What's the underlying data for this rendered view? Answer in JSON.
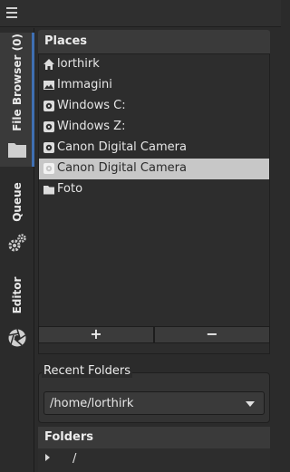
{
  "rail": {
    "tabs": [
      {
        "label": "File Browser (0)",
        "icon": "folder-icon",
        "active": true
      },
      {
        "label": "Queue",
        "icon": "gears-icon",
        "active": false
      },
      {
        "label": "Editor",
        "icon": "aperture-icon",
        "active": false
      }
    ]
  },
  "places": {
    "header": "Places",
    "items": [
      {
        "label": "lorthirk",
        "icon": "home-icon"
      },
      {
        "label": "Immagini",
        "icon": "image-icon"
      },
      {
        "label": "Windows C:",
        "icon": "drive-icon"
      },
      {
        "label": "Windows Z:",
        "icon": "drive-icon"
      },
      {
        "label": "Canon Digital Camera",
        "icon": "camera-icon"
      },
      {
        "label": "Canon Digital Camera",
        "icon": "camera-icon",
        "selected": true
      },
      {
        "label": "Foto",
        "icon": "folder-icon"
      }
    ],
    "add_label": "+",
    "remove_label": "−"
  },
  "recent_folders": {
    "title": "Recent Folders",
    "selected": "/home/lorthirk"
  },
  "folders": {
    "header": "Folders",
    "root": "/"
  },
  "colors": {
    "accent": "#3f6fb2",
    "selected_row": "#c7c7c7",
    "background": "#2b2b2b"
  }
}
